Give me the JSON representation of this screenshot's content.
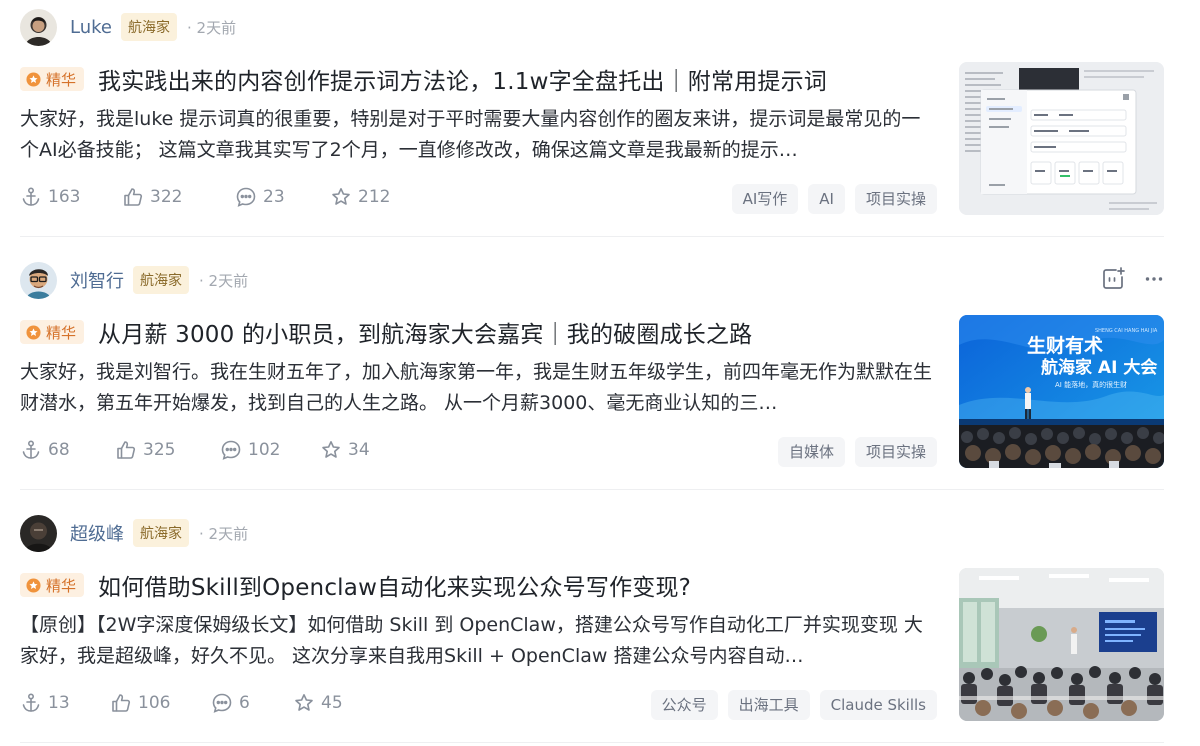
{
  "posts": [
    {
      "author": "Luke",
      "badge": "航海家",
      "time": "· 2天前",
      "essence": "精华",
      "title": "我实践出来的内容创作提示词方法论，1.1w字全盘托出｜附常用提示词",
      "summary": "大家好，我是luke 提示词真的很重要，特别是对于平时需要大量内容创作的圈友来讲，提示词是最常见的一个AI必备技能；  这篇文章我其实写了2个月，一直修修改改，确保这篇文章是我最新的提示…",
      "stats": {
        "anchor": "163",
        "likes": "322",
        "comments": "23",
        "stars": "212"
      },
      "tags": [
        "AI写作",
        "AI",
        "项目实操"
      ]
    },
    {
      "author": "刘智行",
      "badge": "航海家",
      "time": "· 2天前",
      "essence": "精华",
      "title": "从月薪 3000 的小职员，到航海家大会嘉宾｜我的破圈成长之路",
      "summary": "大家好，我是刘智行。我在生财五年了，加入航海家第一年，我是生财五年级学生，前四年毫无作为默默在生财潜水，第五年开始爆发，找到自己的人生之路。 从一个月薪3000、毫无商业认知的三…",
      "stats": {
        "anchor": "68",
        "likes": "325",
        "comments": "102",
        "stars": "34"
      },
      "tags": [
        "自媒体",
        "项目实操"
      ],
      "thumb_text": {
        "line1": "生财有术",
        "line2": "航海家 AI 大会",
        "line3": "AI 能落地，真的很生财",
        "pinyin": "SHENG CAI HANG HAI JIA"
      }
    },
    {
      "author": "超级峰",
      "badge": "航海家",
      "time": "· 2天前",
      "essence": "精华",
      "title": "如何借助Skill到Openclaw自动化来实现公众号写作变现?",
      "summary": "【原创】【2W字深度保姆级长文】如何借助 Skill 到 OpenClaw，搭建公众号写作自动化工厂并实现变现 大家好，我是超级峰，好久不见。 这次分享来自我用Skill + OpenClaw 搭建公众号内容自动…",
      "stats": {
        "anchor": "13",
        "likes": "106",
        "comments": "6",
        "stars": "45"
      },
      "tags": [
        "公众号",
        "出海工具",
        "Claude Skills"
      ]
    }
  ],
  "colors": {
    "author_name": "#4f6c93",
    "badge_bg": "#fbf1dc",
    "essence_bg": "#fdf0e1",
    "essence_text": "#d5722a",
    "tag_bg": "#f4f5f7",
    "meta_gray": "#8a919c"
  },
  "icons": {
    "stats": [
      "anchor-icon",
      "like-icon",
      "comment-icon",
      "star-icon"
    ],
    "actions": [
      "add-to-collection-icon",
      "more-icon"
    ]
  }
}
